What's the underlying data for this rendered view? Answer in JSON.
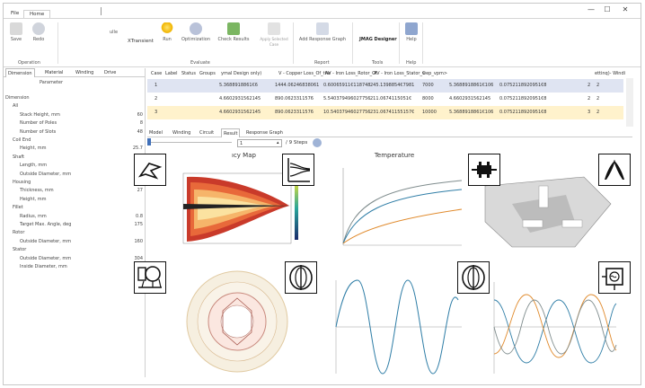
{
  "menu": {
    "file": "File",
    "home": "Home"
  },
  "window": {
    "minimize": "—",
    "maximize": "☐",
    "close": "✕"
  },
  "ribbon": {
    "buttons": [
      "Save",
      "Redo",
      "Run",
      "Optimization",
      "Check Results",
      "Apply Selected Case",
      "Add Response Graph",
      "Help"
    ],
    "model_label": "ХTransient",
    "small_top": "ulle",
    "jmag": "JMAG Designer",
    "groups": [
      "Operation",
      "Evaluate",
      "Report",
      "Tools",
      "Help"
    ]
  },
  "left_tabs": [
    "Dimension",
    "Material",
    "Winding",
    "Drive"
  ],
  "tree_header": "Parameter",
  "tree": [
    {
      "label": "Dimension",
      "value": ""
    },
    {
      "label": "All",
      "value": ""
    },
    {
      "label": "Stack Height, mm",
      "value": "60"
    },
    {
      "label": "Number of Poles",
      "value": "8"
    },
    {
      "label": "Number of Slots",
      "value": "48"
    },
    {
      "label": "Coil End",
      "value": ""
    },
    {
      "label": "Height, mm",
      "value": "25.7"
    },
    {
      "label": "Shaft",
      "value": ""
    },
    {
      "label": "Length, mm",
      "value": "50"
    },
    {
      "label": "Outside Diameter, mm",
      "value": "50"
    },
    {
      "label": "Housing",
      "value": ""
    },
    {
      "label": "Thickness, mm",
      "value": "27"
    },
    {
      "label": "Height, mm",
      "value": ""
    },
    {
      "label": "Fillet",
      "value": ""
    },
    {
      "label": "Radius, mm",
      "value": "0.8"
    },
    {
      "label": "Target Max. Angle, deg",
      "value": "175"
    },
    {
      "label": "Rotor",
      "value": ""
    },
    {
      "label": "Outside Diameter, mm",
      "value": "160"
    },
    {
      "label": "Stator",
      "value": ""
    },
    {
      "label": "Outside Diameter, mm",
      "value": "304"
    },
    {
      "label": "Inside Diameter, mm",
      "value": "161"
    }
  ],
  "grid": {
    "headers": [
      "Case",
      "Label",
      "Status",
      "Groups",
      "ymal Design only)",
      "V - Copper Loss_Of_the",
      "AV - Iron Loss_Rotor_Of",
      "AV - Iron Loss_Stator_C",
      "wep_vpm>",
      "ettinq)- Windi"
    ],
    "rows": [
      {
        "case": "1",
        "c1": "5.3688918861€6",
        "c2": "1444.06246838061",
        "c3": "0.60065911€118748",
        "c4": "245.1398854€7981",
        "c5": "7000",
        "c6": "5.3688918861€106",
        "c7": "0.0752118920951€8",
        "c8": "2",
        "c9": "2"
      },
      {
        "case": "2",
        "c1": "4.6602931562145",
        "c2": "890.0623311576",
        "c3": "5.540379496027756",
        "c4": "211.0674115051€",
        "c5": "8000",
        "c6": "4.6602931562145",
        "c7": "0.0752118920951€8",
        "c8": "2",
        "c9": "2"
      },
      {
        "case": "3",
        "c1": "4.6602931562145",
        "c2": "890.0623311576",
        "c3": "10.54037946027756",
        "c4": "231.06741155157€",
        "c5": "10000",
        "c6": "5.3688918861€106",
        "c7": "0.0752118920951€8",
        "c8": "3",
        "c9": "2"
      }
    ]
  },
  "sub_tabs": [
    "Model",
    "Winding",
    "Circuit",
    "Result",
    "Response Graph"
  ],
  "step": {
    "value": "1",
    "total": "/ 9 Steps"
  },
  "panels": {
    "efficiency_title": "ıcy Map",
    "temperature_title": "Temperature"
  },
  "colors": {
    "accent": "#3f6fb8",
    "highlight_row": "#fff2cc",
    "selected_row": "#dfe4f2",
    "blue_line": "#2e7da6",
    "orange_line": "#e08a2c",
    "gray_line": "#7f8c8d"
  }
}
